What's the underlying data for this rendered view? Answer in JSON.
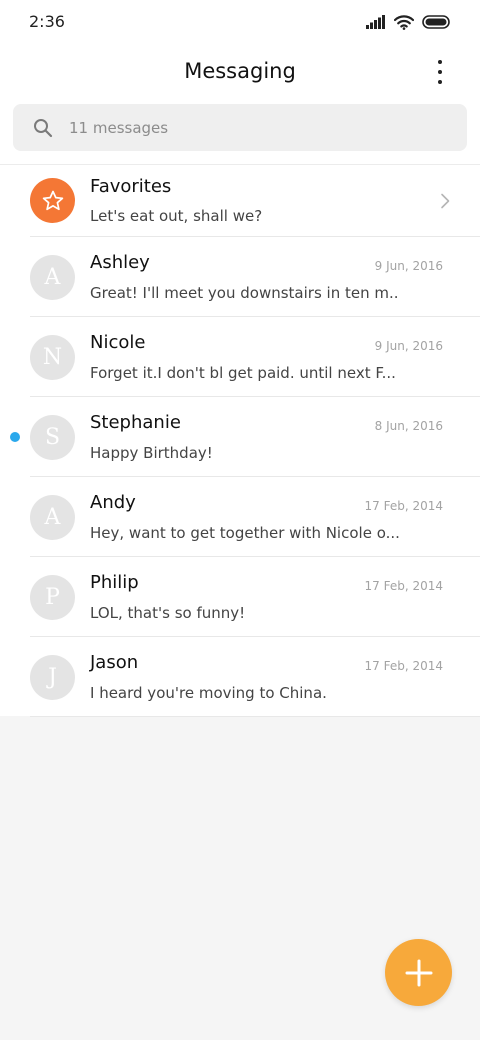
{
  "status_bar": {
    "time": "2:36",
    "icons": [
      "signal-icon",
      "wifi-icon",
      "battery-icon"
    ]
  },
  "header": {
    "title": "Messaging",
    "menu_icon": "more-vertical-icon"
  },
  "search": {
    "placeholder": "11 messages",
    "icon": "search-icon"
  },
  "favorites": {
    "name": "Favorites",
    "preview": "Let's eat out, shall we?",
    "icon": "star-icon",
    "accent_color": "#f47735"
  },
  "conversations": [
    {
      "initial": "A",
      "name": "Ashley",
      "date": "9 Jun, 2016",
      "preview": "Great! I'll meet you downstairs in ten m...",
      "unread": false
    },
    {
      "initial": "N",
      "name": "Nicole",
      "date": "9 Jun, 2016",
      "preview": "Forget it.I don't bl get paid. until next F...",
      "unread": false
    },
    {
      "initial": "S",
      "name": "Stephanie",
      "date": "8 Jun, 2016",
      "preview": "Happy Birthday!",
      "unread": true
    },
    {
      "initial": "A",
      "name": "Andy",
      "date": "17 Feb, 2014",
      "preview": "Hey, want to get together with Nicole o...",
      "unread": false
    },
    {
      "initial": "P",
      "name": "Philip",
      "date": "17 Feb, 2014",
      "preview": "LOL, that's so funny!",
      "unread": false
    },
    {
      "initial": "J",
      "name": "Jason",
      "date": "17 Feb, 2014",
      "preview": "I heard you're moving to China.",
      "unread": false
    }
  ],
  "fab": {
    "icon": "plus-icon",
    "color": "#f7a93b"
  },
  "colors": {
    "unread_dot": "#2aa8ec",
    "avatar_bg": "#e4e4e4",
    "background": "#f5f5f5"
  }
}
